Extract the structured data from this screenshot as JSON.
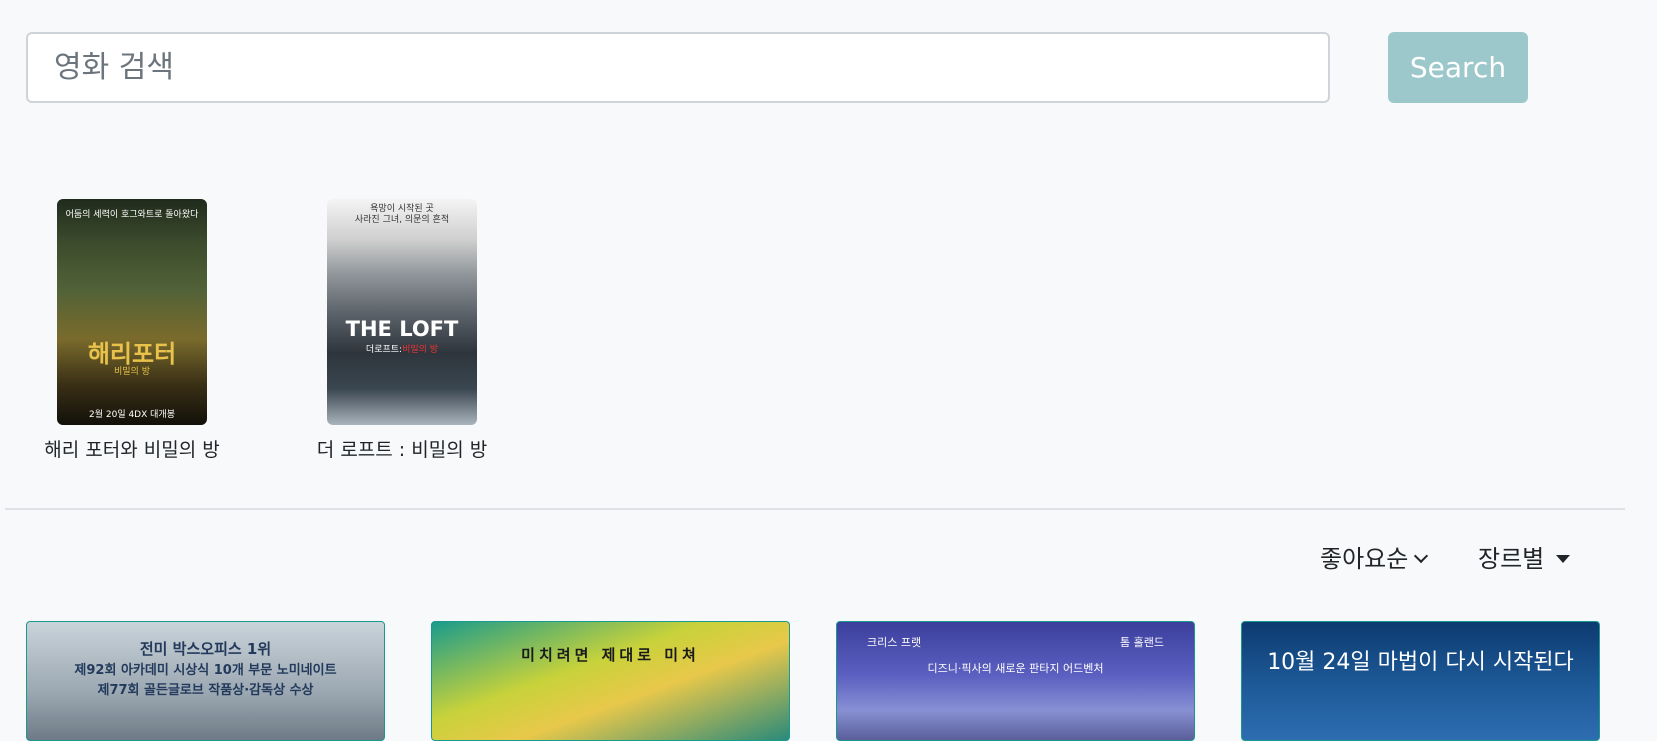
{
  "search": {
    "placeholder": "영화 검색",
    "value": "",
    "button_label": "Search"
  },
  "results": [
    {
      "title": "해리 포터와 비밀의 방",
      "poster_text": {
        "tagline": "어둠의 세력이 호그와트로 돌아왔다",
        "logo": "해리포터",
        "logo_sub": "비밀의 방",
        "release": "2월 20일 4DX 대개봉"
      }
    },
    {
      "title": "더 로프트 : 비밀의 방",
      "poster_text": {
        "tagline_1": "욕망이 시작된 곳",
        "tagline_2": "사라진 그녀, 의문의 흔적",
        "logo": "THE LOFT",
        "logo_sub_1": "더로프트:",
        "logo_sub_2": "비밀의 방"
      }
    }
  ],
  "filters": {
    "sort_label": "좋아요순",
    "genre_label": "장르별"
  },
  "movie_cards": [
    {
      "lines": [
        "전미 박스오피스 1위",
        "제92회 아카데미 시상식 10개 부문 노미네이트",
        "제77회 골든글로브 작품상·감독상 수상"
      ]
    },
    {
      "lines": [
        "미치려면 제대로 미쳐"
      ]
    },
    {
      "lines": [
        "크리스 프랫",
        "톰 홀랜드",
        "디즈니·픽사의 새로운 판타지 어드벤처"
      ]
    },
    {
      "lines": [
        "10월 24일 마법이 다시 시작된다"
      ]
    }
  ],
  "colors": {
    "background": "#f8f9fa",
    "search_button": "#9cc8cb",
    "card_border": "#1a9a8f"
  }
}
